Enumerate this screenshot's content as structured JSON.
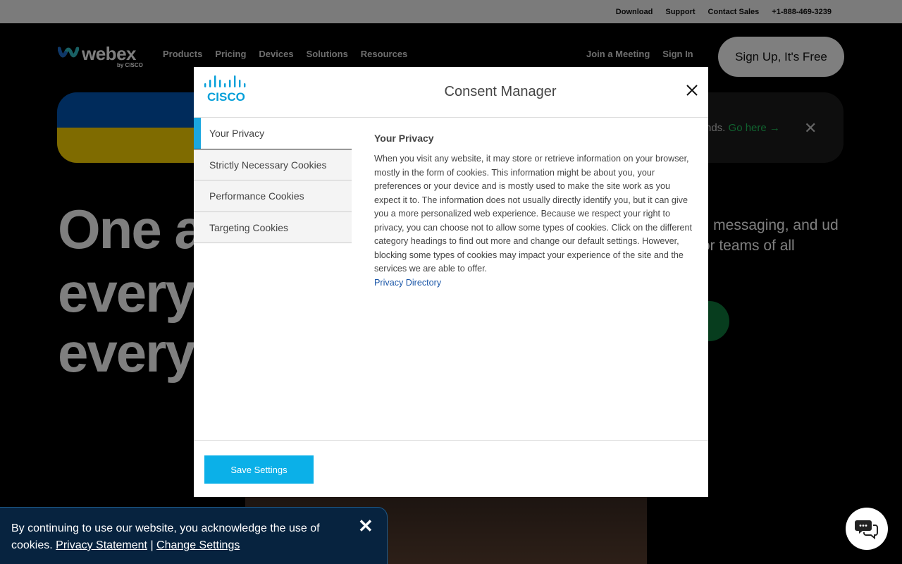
{
  "topbar": {
    "links": [
      "Download",
      "Support",
      "Contact Sales",
      "+1-888-469-3239"
    ]
  },
  "nav": {
    "logo_text": "webex",
    "logo_by": "by CISCO",
    "links": [
      "Products",
      "Pricing",
      "Devices",
      "Solutions",
      "Resources"
    ],
    "join": "Join a Meeting",
    "signin": "Sign In",
    "signup": "Sign Up, It's Free"
  },
  "banner": {
    "text": "nds.",
    "link": "Go here →"
  },
  "hero": {
    "line1": "One a",
    "line2": "every",
    "line3": "every",
    "right_text": "s, messaging, and ud for teams of all"
  },
  "modal": {
    "brand": "CISCO",
    "title": "Consent Manager",
    "tabs": [
      "Your Privacy",
      "Strictly Necessary Cookies",
      "Performance Cookies",
      "Targeting Cookies"
    ],
    "content_title": "Your Privacy",
    "content_body": "When you visit any website, it may store or retrieve information on your browser, mostly in the form of cookies. This information might be about you, your preferences or your device and is mostly used to make the site work as you expect it to. The information does not usually directly identify you, but it can give you a more personalized web experience. Because we respect your right to privacy, you can choose not to allow some types of cookies. Click on the different category headings to find out more and change our default settings. However, blocking some types of cookies may impact your experience of the site and the services we are able to offer.",
    "content_link": "Privacy Directory",
    "save_label": "Save Settings"
  },
  "cookie_bar": {
    "text": "By continuing to use our website, you acknowledge the use of cookies.",
    "privacy_link": "Privacy Statement",
    "separator": "|",
    "settings_link": "Change Settings"
  },
  "colors": {
    "accent": "#0bb0e8",
    "active_tab_marker": "#1aa7e0",
    "link": "#1a56a8",
    "cookie_bar_bg": "#07233f"
  }
}
